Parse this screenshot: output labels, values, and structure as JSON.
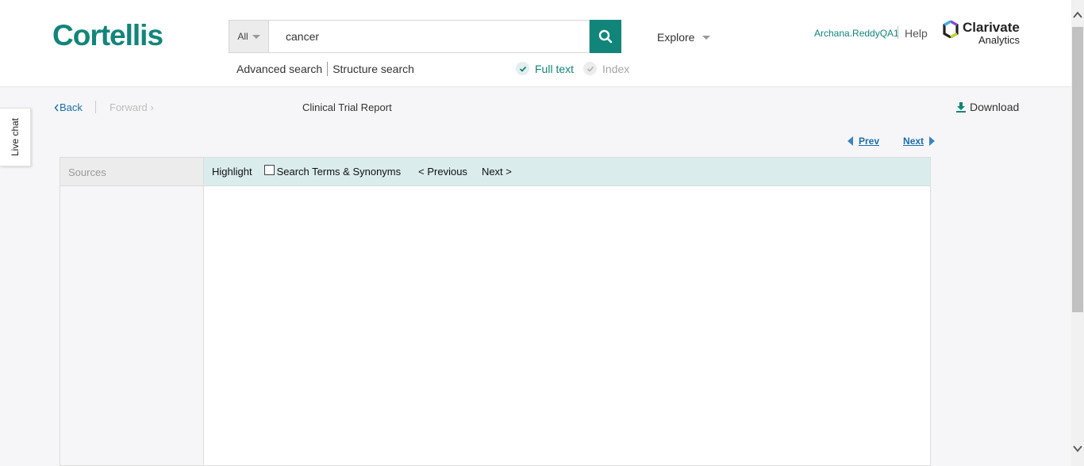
{
  "header": {
    "logo": "Cortellis",
    "search_scope": "All",
    "search_value": "cancer",
    "advanced_search": "Advanced search",
    "structure_search": "Structure search",
    "full_text": "Full text",
    "index": "Index",
    "explore": "Explore",
    "user": "Archana.ReddyQA1",
    "help": "Help",
    "brand_line1": "Clarivate",
    "brand_line2": "Analytics"
  },
  "nav": {
    "back": "Back",
    "forward": "Forward",
    "title": "Clinical Trial Report",
    "download": "Download"
  },
  "livechat": "Live chat",
  "pager": {
    "prev": "Prev",
    "next": "Next"
  },
  "sources": {
    "header": "Sources"
  },
  "toolbar": {
    "highlight": "Highlight",
    "terms": "Search Terms & Synonyms",
    "previous": "< Previous",
    "next": "Next >"
  },
  "colors": {
    "brand_teal": "#12857a",
    "link_blue": "#1b6ea8",
    "toolbar_bg": "#dbecec"
  }
}
